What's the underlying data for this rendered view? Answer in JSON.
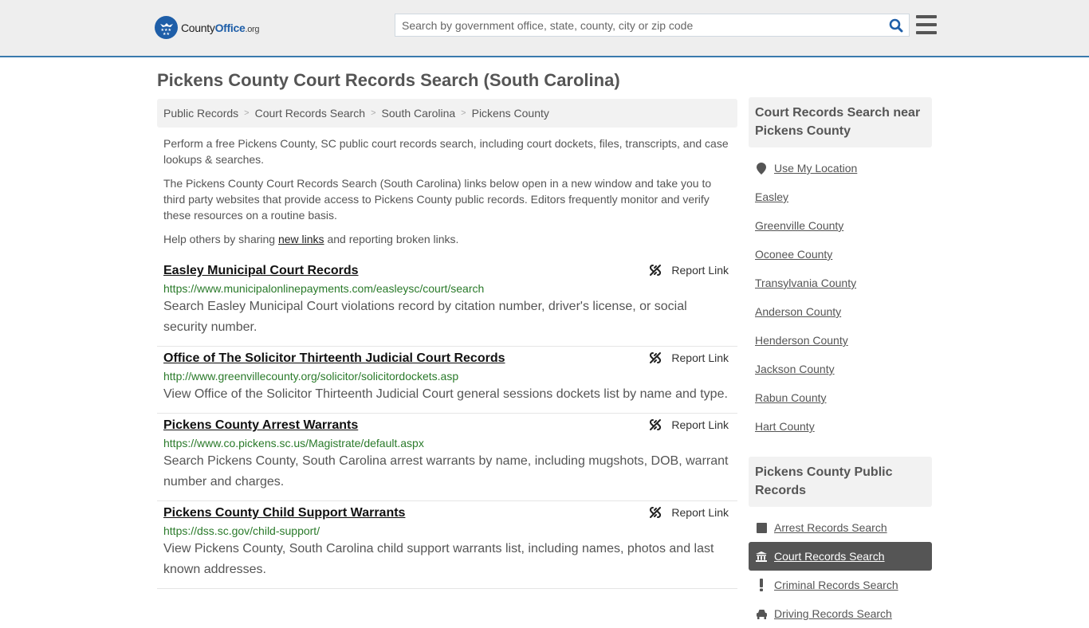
{
  "header": {
    "logo": {
      "county": "County",
      "office": "Office",
      "org": ".org"
    },
    "search": {
      "placeholder": "Search by government office, state, county, city or zip code",
      "value": ""
    },
    "accent_color": "#1e5ea8",
    "border_color": "#3a7aad"
  },
  "page_title": "Pickens County Court Records Search (South Carolina)",
  "breadcrumb": [
    {
      "label": "Public Records"
    },
    {
      "label": "Court Records Search"
    },
    {
      "label": "South Carolina"
    },
    {
      "label": "Pickens County"
    }
  ],
  "intro": {
    "p1": "Perform a free Pickens County, SC public court records search, including court dockets, files, transcripts, and case lookups & searches.",
    "p2": "The Pickens County Court Records Search (South Carolina) links below open in a new window and take you to third party websites that provide access to Pickens County public records. Editors frequently monitor and verify these resources on a routine basis.",
    "p3_before": "Help others by sharing ",
    "p3_link": "new links",
    "p3_after": " and reporting broken links."
  },
  "report_label": "Report Link",
  "results": [
    {
      "title": "Easley Municipal Court Records",
      "url": "https://www.municipalonlinepayments.com/easleysc/court/search",
      "description": "Search Easley Municipal Court violations record by citation number, driver's license, or social security number."
    },
    {
      "title": "Office of The Solicitor Thirteenth Judicial Court Records",
      "url": "http://www.greenvillecounty.org/solicitor/solicitordockets.asp",
      "description": "View Office of the Solicitor Thirteenth Judicial Court general sessions dockets list by name and type."
    },
    {
      "title": "Pickens County Arrest Warrants",
      "url": "https://www.co.pickens.sc.us/Magistrate/default.aspx",
      "description": "Search Pickens County, South Carolina arrest warrants by name, including mugshots, DOB, warrant number and charges."
    },
    {
      "title": "Pickens County Child Support Warrants",
      "url": "https://dss.sc.gov/child-support/",
      "description": "View Pickens County, South Carolina child support warrants list, including names, photos and last known addresses."
    }
  ],
  "sidebar": {
    "nearby": {
      "heading": "Court Records Search near Pickens County",
      "use_location": "Use My Location",
      "items": [
        "Easley",
        "Greenville County",
        "Oconee County",
        "Transylvania County",
        "Anderson County",
        "Henderson County",
        "Jackson County",
        "Rabun County",
        "Hart County"
      ]
    },
    "public_records": {
      "heading": "Pickens County Public Records",
      "items": [
        {
          "label": "Arrest Records Search",
          "icon": "square-icon",
          "active": false
        },
        {
          "label": "Court Records Search",
          "icon": "courthouse-icon",
          "active": true
        },
        {
          "label": "Criminal Records Search",
          "icon": "exclamation-icon",
          "active": false
        },
        {
          "label": "Driving Records Search",
          "icon": "car-icon",
          "active": false
        }
      ]
    }
  }
}
